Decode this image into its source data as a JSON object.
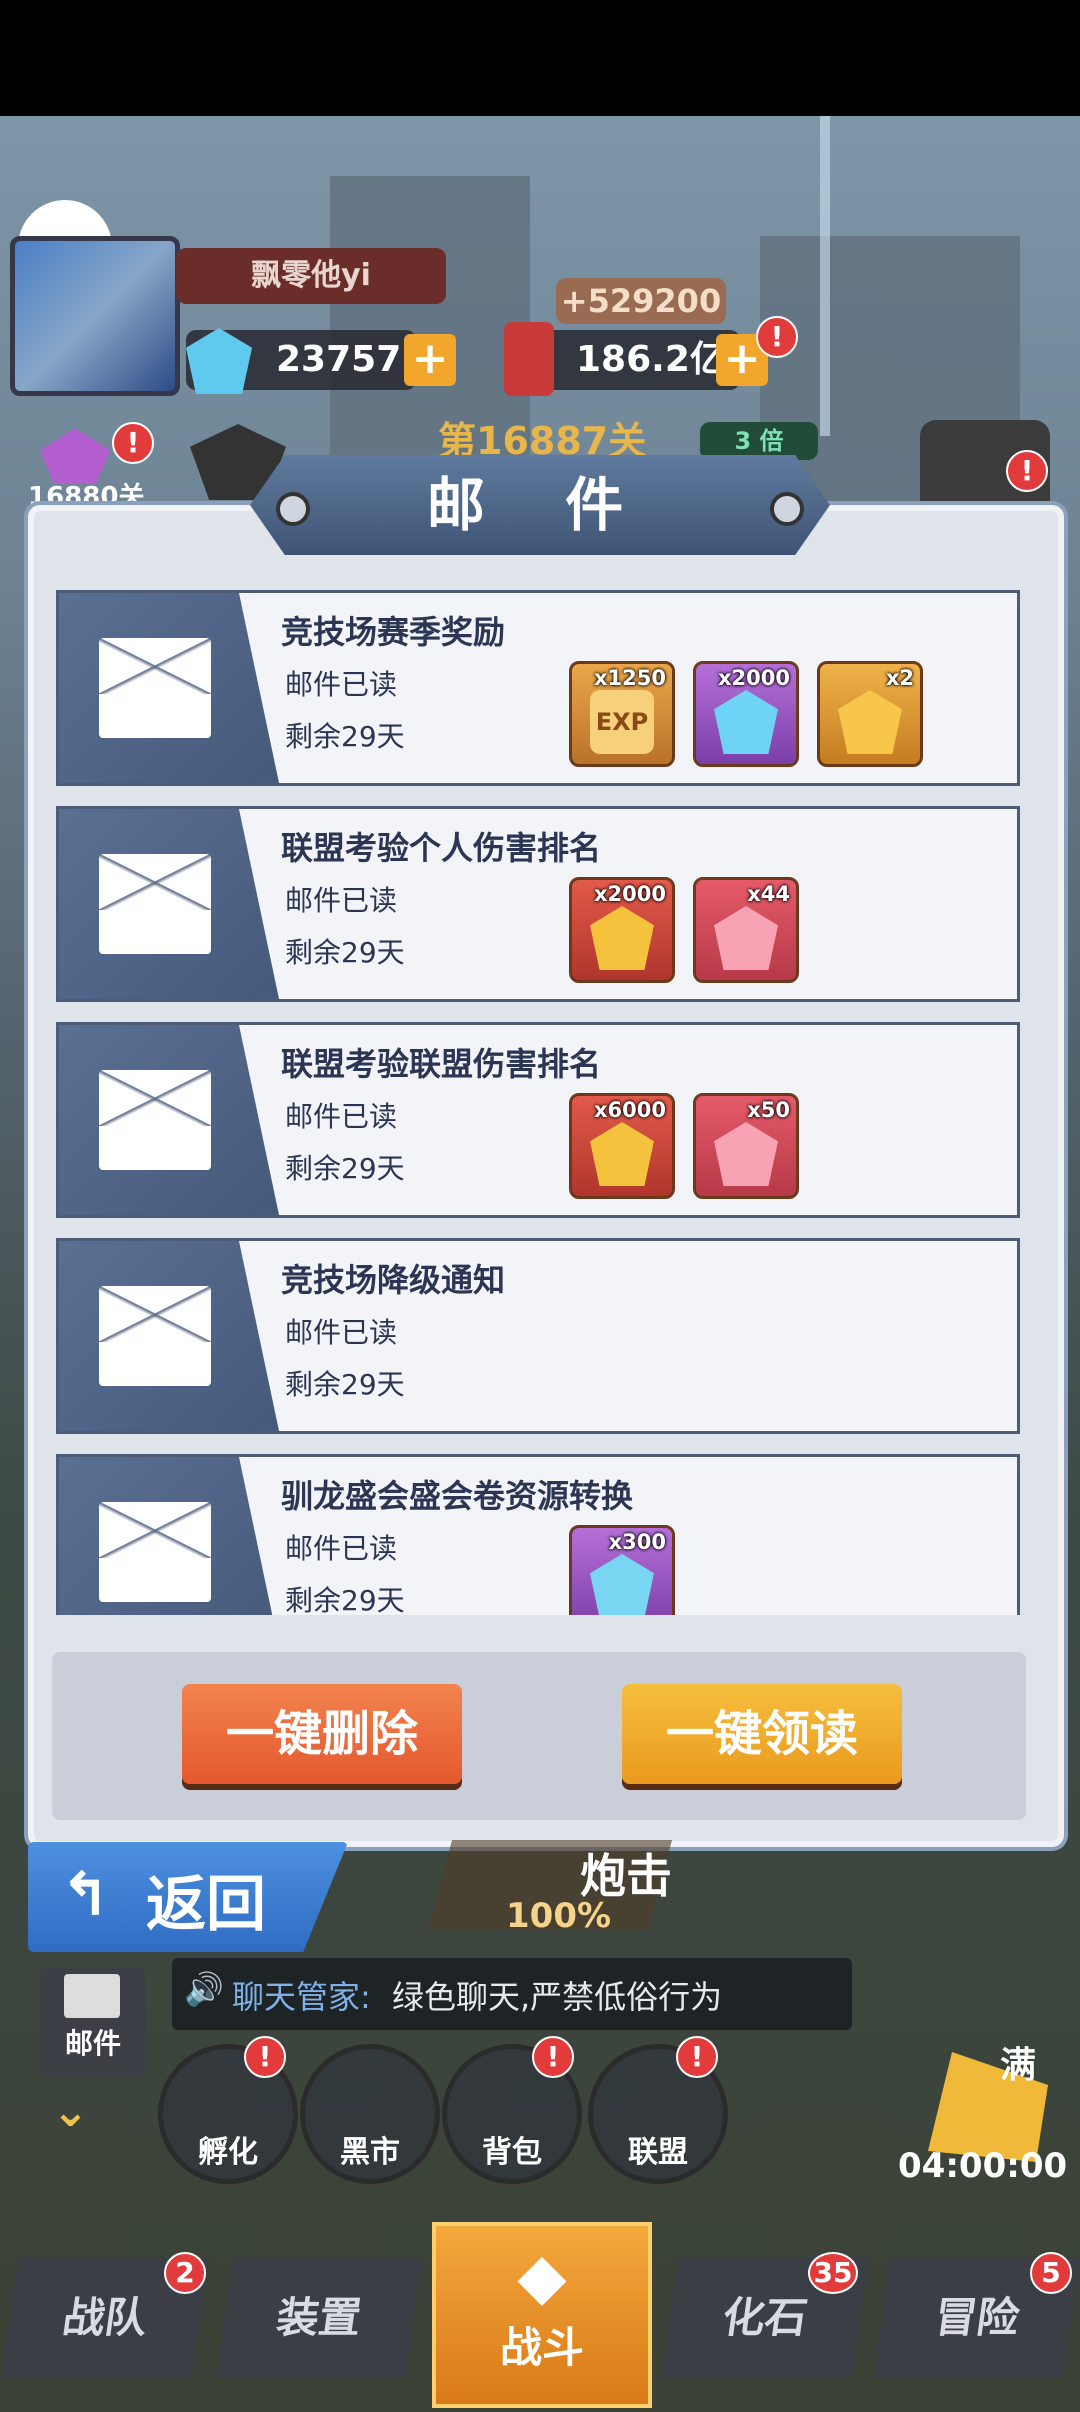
{
  "player": {
    "name": "飘零他yi",
    "gems": "23757",
    "cans": "186.2亿",
    "cans_gain": "+529200",
    "stage": "第16887关",
    "speed": "3 倍",
    "side_stage": "16880关"
  },
  "dialog": {
    "title": "邮 件",
    "mails": [
      {
        "title": "竞技场赛季奖励",
        "status": "邮件已读",
        "remain": "剩余29天",
        "rewards": [
          {
            "icon": "exp-icon",
            "qty": "x1250",
            "label": "EXP"
          },
          {
            "icon": "blue-diamond-icon",
            "qty": "x2000"
          },
          {
            "icon": "gold-crystal-icon",
            "qty": "x2"
          }
        ]
      },
      {
        "title": "联盟考验个人伤害排名",
        "status": "邮件已读",
        "remain": "剩余29天",
        "rewards": [
          {
            "icon": "gold-badge-icon",
            "qty": "x2000"
          },
          {
            "icon": "pink-heart-icon",
            "qty": "x44"
          }
        ]
      },
      {
        "title": "联盟考验联盟伤害排名",
        "status": "邮件已读",
        "remain": "剩余29天",
        "rewards": [
          {
            "icon": "gold-badge-icon",
            "qty": "x6000"
          },
          {
            "icon": "mystery-box-icon",
            "qty": "x50"
          }
        ]
      },
      {
        "title": "竞技场降级通知",
        "status": "邮件已读",
        "remain": "剩余29天",
        "rewards": []
      },
      {
        "title": "驯龙盛会盛会卷资源转换",
        "status": "邮件已读",
        "remain": "剩余29天",
        "rewards": [
          {
            "icon": "purple-diamond-icon",
            "qty": "x300"
          }
        ]
      }
    ],
    "delete_all": "一键删除",
    "read_all": "一键领读"
  },
  "back_label": "返回",
  "event_banner": {
    "title": "炮击",
    "percent": "100%"
  },
  "chat": {
    "label": "聊天管家:",
    "text": "绿色聊天,严禁低俗行为"
  },
  "mail_shortcut": "邮件",
  "round_buttons": [
    "孵化",
    "黑市",
    "背包",
    "联盟"
  ],
  "timer": "04:00:00",
  "full_label": "满",
  "tabs": [
    {
      "label": "战队",
      "badge": "2"
    },
    {
      "label": "装置",
      "badge": ""
    },
    {
      "label": "战斗",
      "badge": ""
    },
    {
      "label": "化石",
      "badge": "35"
    },
    {
      "label": "冒险",
      "badge": "5"
    }
  ],
  "colors": {
    "accent_orange": "#f2a62b",
    "delete_red": "#e8623a",
    "panel_blue": "#4d5d78"
  }
}
